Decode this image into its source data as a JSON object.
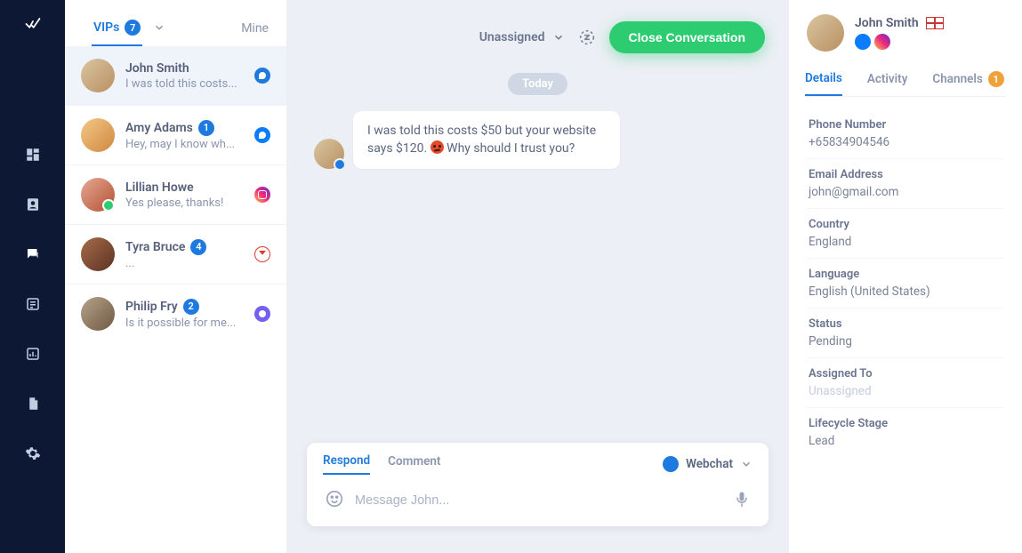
{
  "tabs": {
    "vips_label": "VIPs",
    "vips_count": "7",
    "mine_label": "Mine"
  },
  "conversations": [
    {
      "name": "John Smith",
      "preview": "I was told this costs...",
      "unread": "",
      "channel": "webchat",
      "selected": true,
      "status": ""
    },
    {
      "name": "Amy Adams",
      "preview": "Hey, may I know wh...",
      "unread": "1",
      "channel": "messenger",
      "selected": false,
      "status": ""
    },
    {
      "name": "Lillian Howe",
      "preview": "Yes please, thanks!",
      "unread": "",
      "channel": "instagram",
      "selected": false,
      "status": "online"
    },
    {
      "name": "Tyra Bruce",
      "preview": "...",
      "unread": "4",
      "channel": "gmail",
      "selected": false,
      "status": ""
    },
    {
      "name": "Philip Fry",
      "preview": "Is it possible for me...",
      "unread": "2",
      "channel": "viber",
      "selected": false,
      "status": ""
    }
  ],
  "chat": {
    "assignment_label": "Unassigned",
    "close_label": "Close Conversation",
    "date_label": "Today",
    "message_pre": "I was told this costs $50 but your website says $120. ",
    "message_post": " Why should I trust you?",
    "composer": {
      "respond_label": "Respond",
      "comment_label": "Comment",
      "channel_label": "Webchat",
      "placeholder": "Message John..."
    }
  },
  "details": {
    "name": "John Smith",
    "tabs": {
      "details": "Details",
      "activity": "Activity",
      "channels": "Channels",
      "channels_count": "1"
    },
    "fields": {
      "phone_label": "Phone Number",
      "phone_value": "+65834904546",
      "email_label": "Email Address",
      "email_value": "john@gmail.com",
      "country_label": "Country",
      "country_value": "England",
      "language_label": "Language",
      "language_value": "English (United States)",
      "status_label": "Status",
      "status_value": "Pending",
      "assigned_label": "Assigned To",
      "assigned_value": "Unassigned",
      "lifecycle_label": "Lifecycle Stage",
      "lifecycle_value": "Lead"
    }
  }
}
